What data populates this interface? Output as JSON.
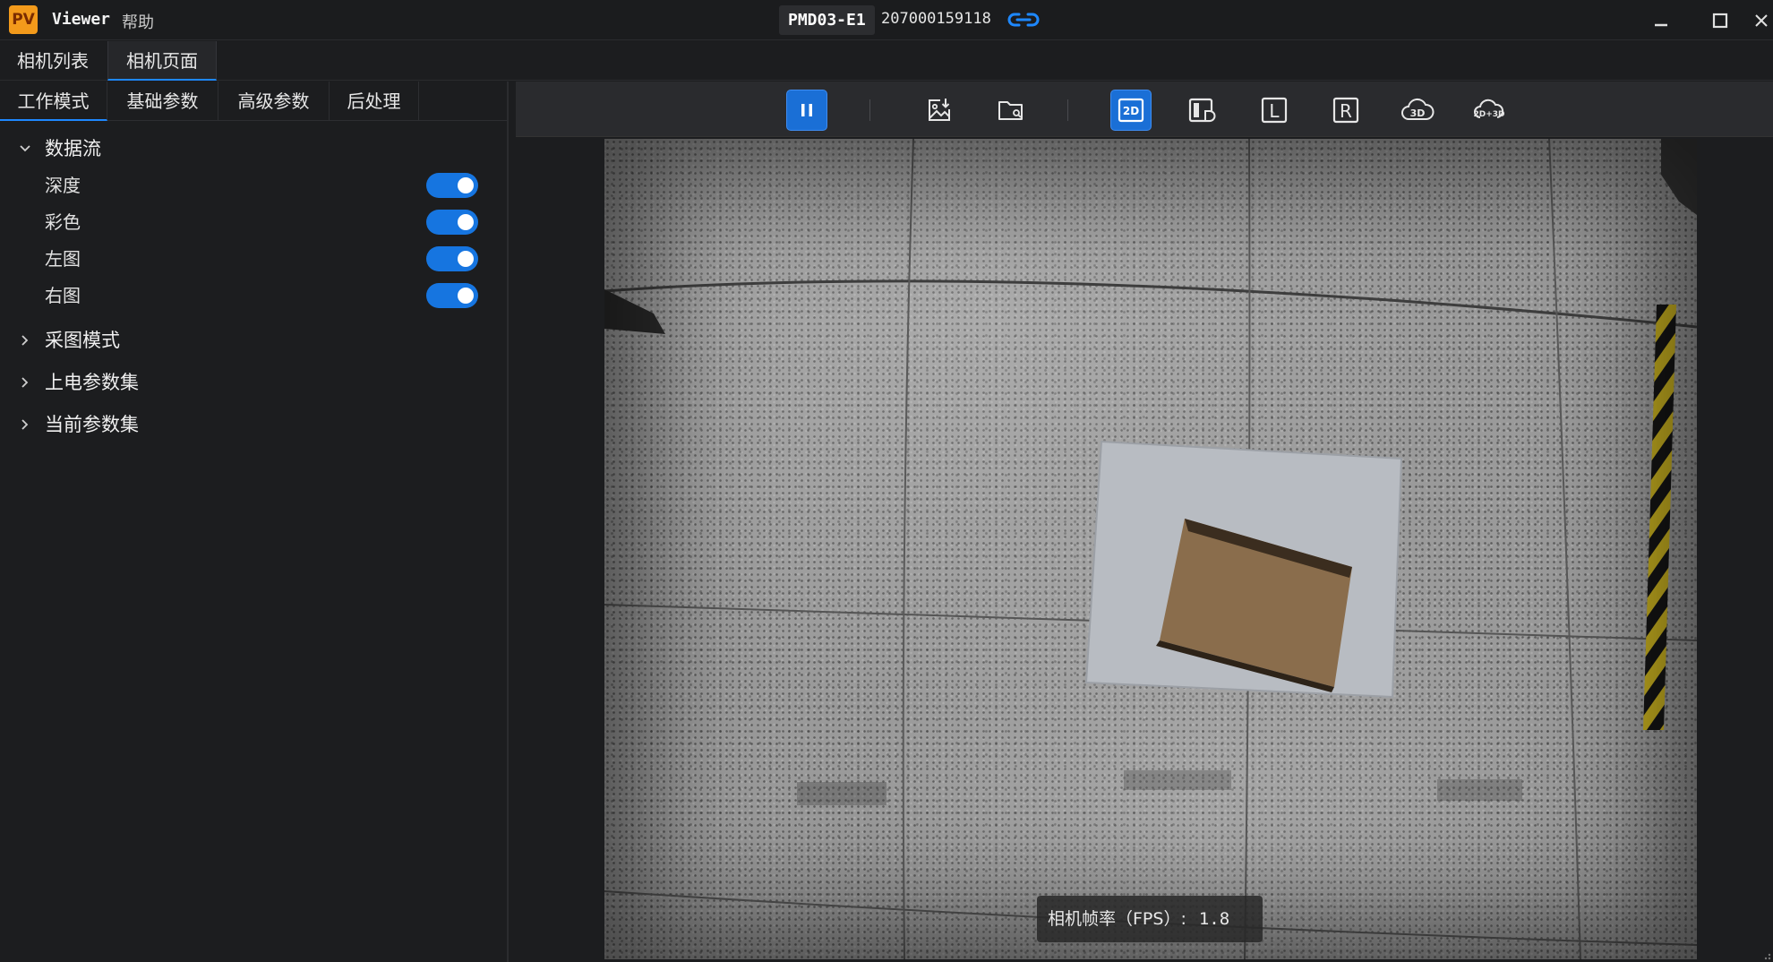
{
  "titlebar": {
    "logo_text": "PV",
    "app_name": "Viewer",
    "menu_help": "帮助",
    "camera_model": "PMD03-E1",
    "serial": "207000159118"
  },
  "top_tabs": [
    {
      "label": "相机列表",
      "active": false
    },
    {
      "label": "相机页面",
      "active": true
    }
  ],
  "sub_tabs": [
    {
      "label": "工作模式",
      "active": true
    },
    {
      "label": "基础参数",
      "active": false
    },
    {
      "label": "高级参数",
      "active": false
    },
    {
      "label": "后处理",
      "active": false
    }
  ],
  "tree": {
    "data_stream": {
      "label": "数据流",
      "expanded": true,
      "children": [
        {
          "label": "深度",
          "enabled": true
        },
        {
          "label": "彩色",
          "enabled": true
        },
        {
          "label": "左图",
          "enabled": true
        },
        {
          "label": "右图",
          "enabled": true
        }
      ]
    },
    "collapsed": [
      {
        "label": "采图模式"
      },
      {
        "label": "上电参数集"
      },
      {
        "label": "当前参数集"
      }
    ]
  },
  "toolbar": {
    "pause_active": true,
    "view_2d_active": true,
    "l_label": "L",
    "r_label": "R",
    "label_2d": "2D",
    "label_3d": "3D",
    "label_2d3d": "2D+3D"
  },
  "status": {
    "fps_label": "相机帧率（FPS）:",
    "fps_value": "1.8"
  },
  "colors": {
    "accent": "#1e88ff",
    "toggle_on": "#1675e0",
    "background": "#1c1d1f"
  }
}
